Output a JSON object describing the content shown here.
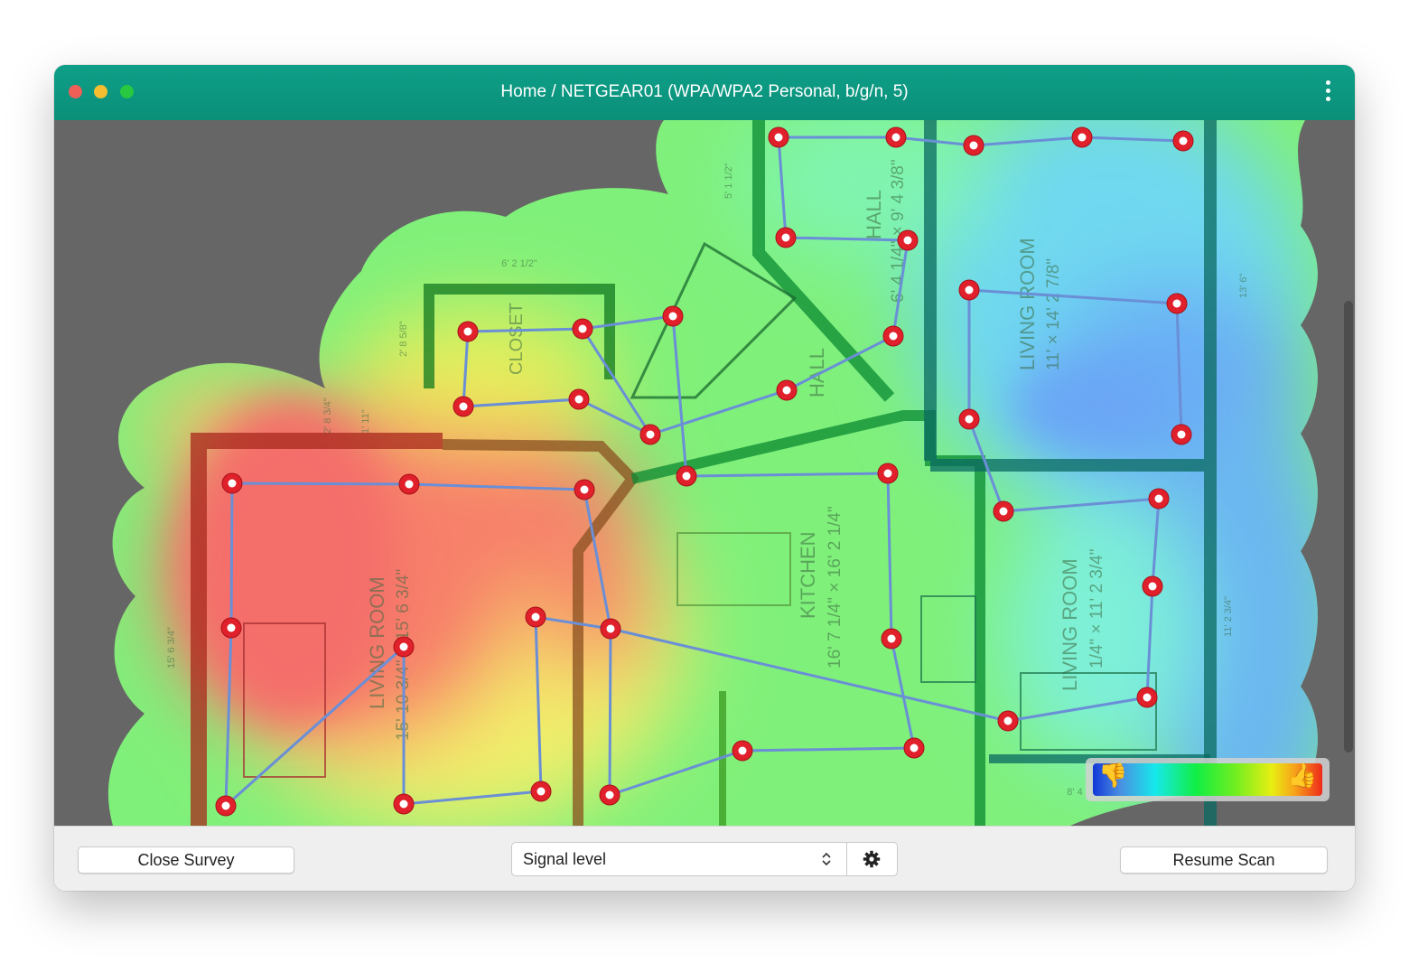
{
  "window": {
    "title": "Home / NETGEAR01 (WPA/WPA2 Personal, b/g/n, 5)",
    "traffic_lights": {
      "close": "#ee5f57",
      "minimize": "#f5bd2f",
      "zoom": "#28c840"
    },
    "titlebar_color": "#0e9a84",
    "menu_icon": "more-vertical-icon"
  },
  "floorplan": {
    "labels": {
      "hall_top": "HALL",
      "hall_top_dims": "6' 4 1/4\" × 9' 4 3/8\"",
      "hall_mid": "HALL",
      "living_right_top": "LIVING ROOM",
      "living_right_top_dims": "11' × 14' 2 7/8\"",
      "kitchen": "KITCHEN",
      "kitchen_dims": "16' 7 1/4\" × 16' 2 1/4\"",
      "closet": "CLOSET",
      "living_left": "LIVING ROOM",
      "living_left_dims": "15' 10 3/4\" × 15' 6 3/4\"",
      "living_right_bottom": "LIVING ROOM",
      "living_right_bottom_dims": "1/4\" × 11' 2 3/4\"",
      "dim_closet": "6' 2 1/2\"",
      "dim_stairs": "5' 1 1/2\"",
      "dim_right": "13' 6\"",
      "dim_left": "15' 6 3/4\"",
      "dim_right_bottom": "11' 2 3/4\"",
      "dim_closet_side": "2' 8 5/8\"",
      "dim_door": "1' 11\"",
      "dim_hall_side": "2' 8 3/4\"",
      "dim_bottom": "8' 4"
    }
  },
  "legend": {
    "low_icon": "thumbs-down-icon",
    "high_icon": "thumbs-up-icon",
    "gradient": [
      "#1238d8",
      "#17e8ec",
      "#11ee44",
      "#e8ee12",
      "#ee2a1b"
    ]
  },
  "survey_point_color": "#e0202a",
  "path_color": "#6a8fd6",
  "bottom_bar": {
    "close_survey_label": "Close Survey",
    "visualization_select": "Signal level",
    "settings_icon": "gear-icon",
    "resume_scan_label": "Resume Scan"
  }
}
